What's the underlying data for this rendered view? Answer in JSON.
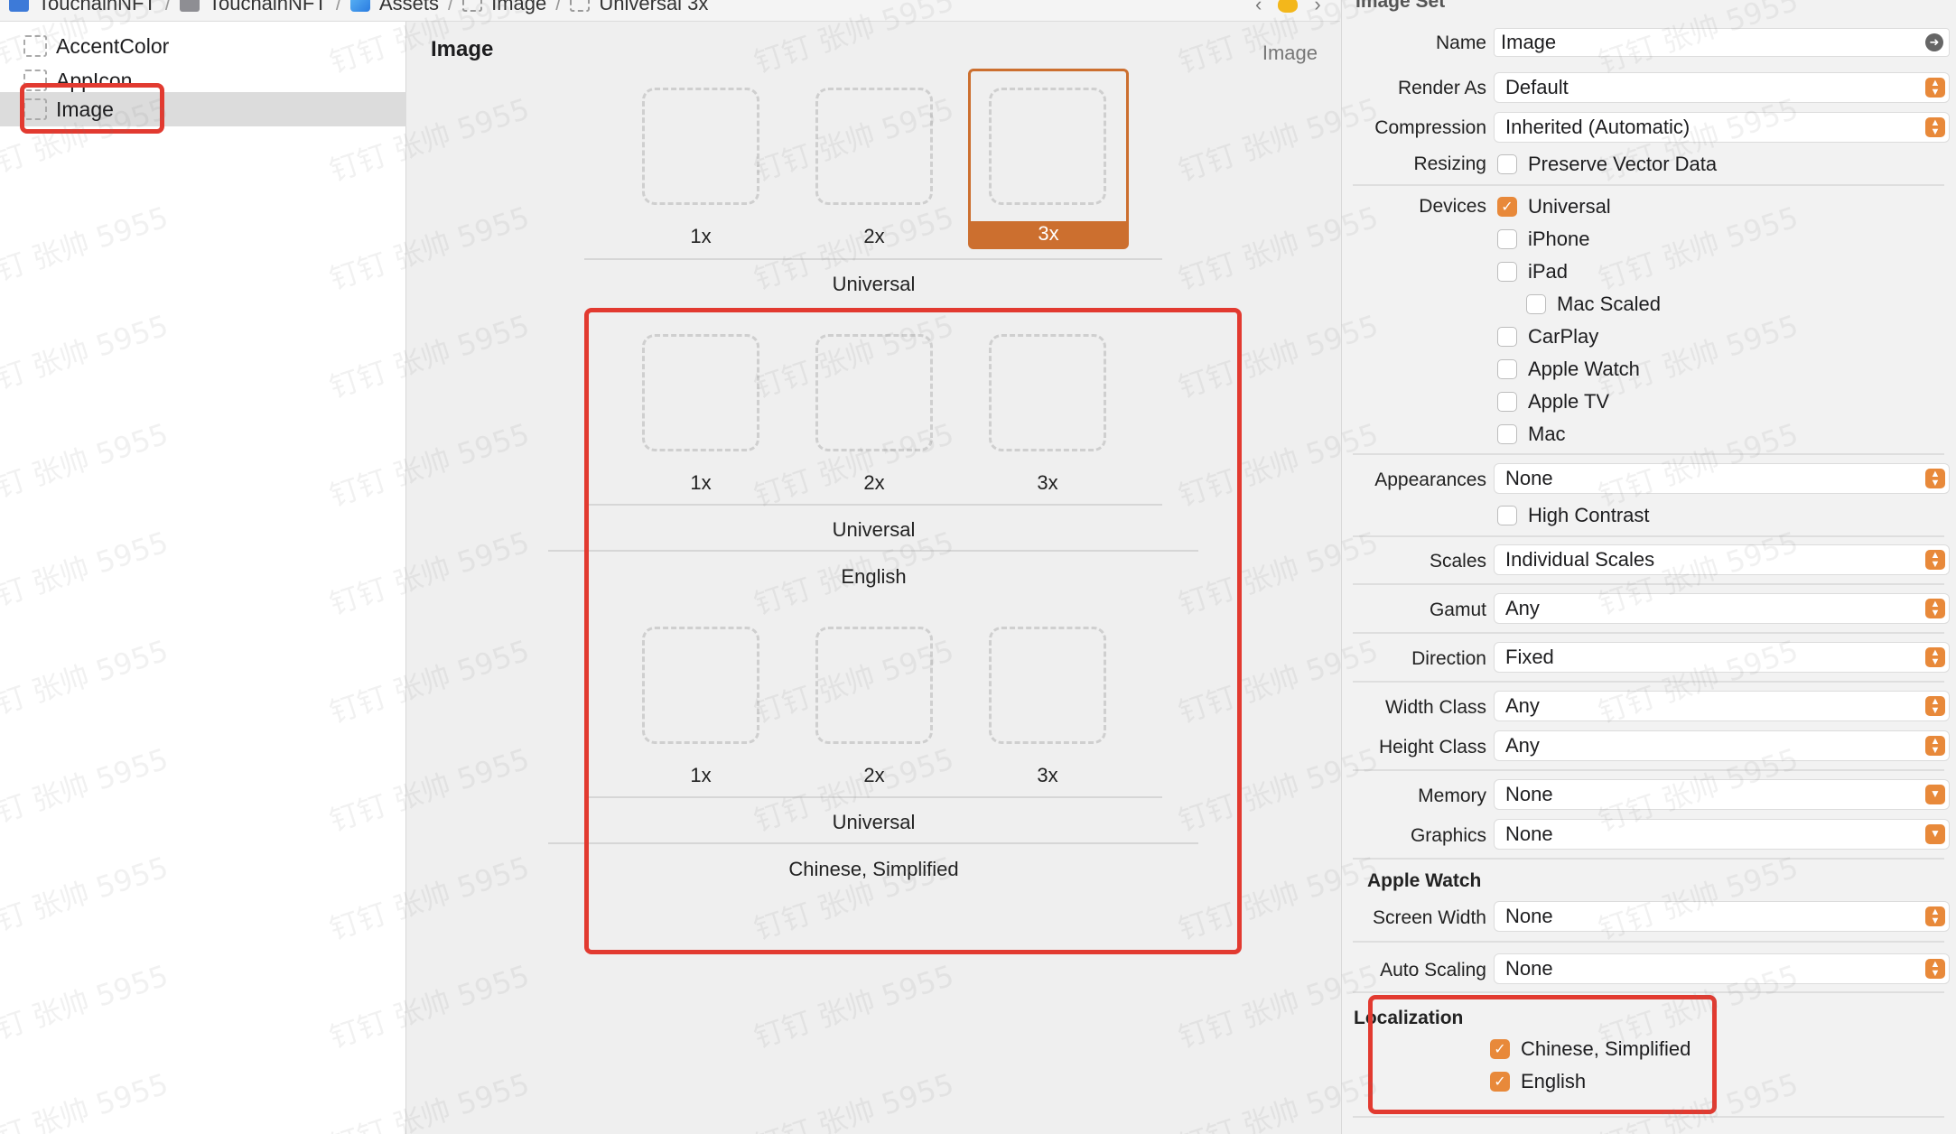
{
  "breadcrumb": {
    "items": [
      {
        "label": "TouchainNFT",
        "icon": "project-icon"
      },
      {
        "label": "TouchainNFT",
        "icon": "folder-icon"
      },
      {
        "label": "Assets",
        "icon": "asset-catalog-icon"
      },
      {
        "label": "Image",
        "icon": "image-set-icon"
      },
      {
        "label": "Universal 3x",
        "icon": "image-set-icon"
      }
    ]
  },
  "navigator": {
    "items": [
      {
        "label": "AccentColor",
        "selected": false
      },
      {
        "label": "AppIcon",
        "selected": false
      },
      {
        "label": "Image",
        "selected": true
      }
    ]
  },
  "editor": {
    "title": "Image",
    "kind_label": "Image",
    "top_group": {
      "slots": [
        "1x",
        "2x",
        "3x"
      ],
      "selected_slot": "3x",
      "device_label": "Universal"
    },
    "localized_groups": [
      {
        "slots": [
          "1x",
          "2x",
          "3x"
        ],
        "device_label": "Universal",
        "language": "English"
      },
      {
        "slots": [
          "1x",
          "2x",
          "3x"
        ],
        "device_label": "Universal",
        "language": "Chinese, Simplified"
      }
    ]
  },
  "inspector": {
    "header": "Image Set",
    "name": {
      "label": "Name",
      "value": "Image"
    },
    "render_as": {
      "label": "Render As",
      "value": "Default"
    },
    "compression": {
      "label": "Compression",
      "value": "Inherited (Automatic)"
    },
    "resizing": {
      "label": "Resizing",
      "option": "Preserve Vector Data",
      "checked": false
    },
    "devices": {
      "label": "Devices",
      "options": [
        {
          "label": "Universal",
          "checked": true
        },
        {
          "label": "iPhone",
          "checked": false
        },
        {
          "label": "iPad",
          "checked": false
        },
        {
          "label": "Mac Scaled",
          "checked": false
        },
        {
          "label": "CarPlay",
          "checked": false
        },
        {
          "label": "Apple Watch",
          "checked": false
        },
        {
          "label": "Apple TV",
          "checked": false
        },
        {
          "label": "Mac",
          "checked": false
        }
      ]
    },
    "appearances": {
      "label": "Appearances",
      "value": "None",
      "option": "High Contrast",
      "checked": false
    },
    "scales": {
      "label": "Scales",
      "value": "Individual Scales"
    },
    "gamut": {
      "label": "Gamut",
      "value": "Any"
    },
    "direction": {
      "label": "Direction",
      "value": "Fixed"
    },
    "width_class": {
      "label": "Width Class",
      "value": "Any"
    },
    "height_class": {
      "label": "Height Class",
      "value": "Any"
    },
    "memory": {
      "label": "Memory",
      "value": "None"
    },
    "graphics": {
      "label": "Graphics",
      "value": "None"
    },
    "apple_watch": {
      "title": "Apple Watch",
      "screen_width_label": "Screen Width",
      "screen_width_value": "None"
    },
    "auto_scaling": {
      "label": "Auto Scaling",
      "value": "None"
    },
    "localization": {
      "title": "Localization",
      "options": [
        {
          "label": "Chinese, Simplified",
          "checked": true
        },
        {
          "label": "English",
          "checked": true
        }
      ]
    }
  },
  "watermark": "钉钉 张帅 5955",
  "colors": {
    "accent": "#e8893a",
    "selection": "#cc6f2f",
    "annotation": "#e23a30"
  }
}
